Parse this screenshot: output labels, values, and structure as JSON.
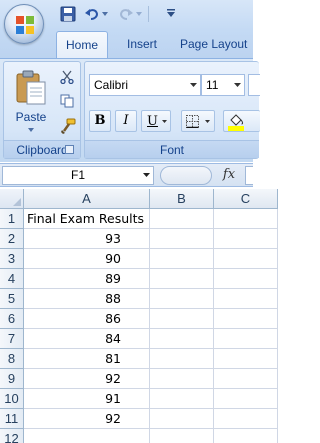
{
  "quick_access": {
    "icons": [
      "office-logo-icon",
      "save-icon",
      "undo-icon",
      "redo-icon",
      "customize-toolbar-icon"
    ]
  },
  "tabs": [
    {
      "label": "Home",
      "active": true
    },
    {
      "label": "Insert",
      "active": false
    },
    {
      "label": "Page Layout",
      "active": false
    }
  ],
  "ribbon": {
    "clipboard": {
      "paste_label": "Paste",
      "group_label": "Clipboard"
    },
    "font": {
      "font_name": "Calibri",
      "font_size": "11",
      "bold_label": "B",
      "italic_label": "I",
      "underline_label": "U",
      "group_label": "Font",
      "fill_color": "#ffff00"
    }
  },
  "formula_bar": {
    "name_box": "F1",
    "fx_label": "fx",
    "content": ""
  },
  "sheet": {
    "columns": [
      "A",
      "B",
      "C"
    ],
    "rows": [
      "1",
      "2",
      "3",
      "4",
      "5",
      "6",
      "7",
      "8",
      "9",
      "10",
      "11",
      "12"
    ],
    "cells_a": [
      "Final Exam Results",
      "93",
      "90",
      "89",
      "88",
      "86",
      "84",
      "81",
      "92",
      "91",
      "92",
      ""
    ]
  },
  "colors": {
    "ribbon_text": "#15428b",
    "accent_blue": "#8db2e3"
  }
}
